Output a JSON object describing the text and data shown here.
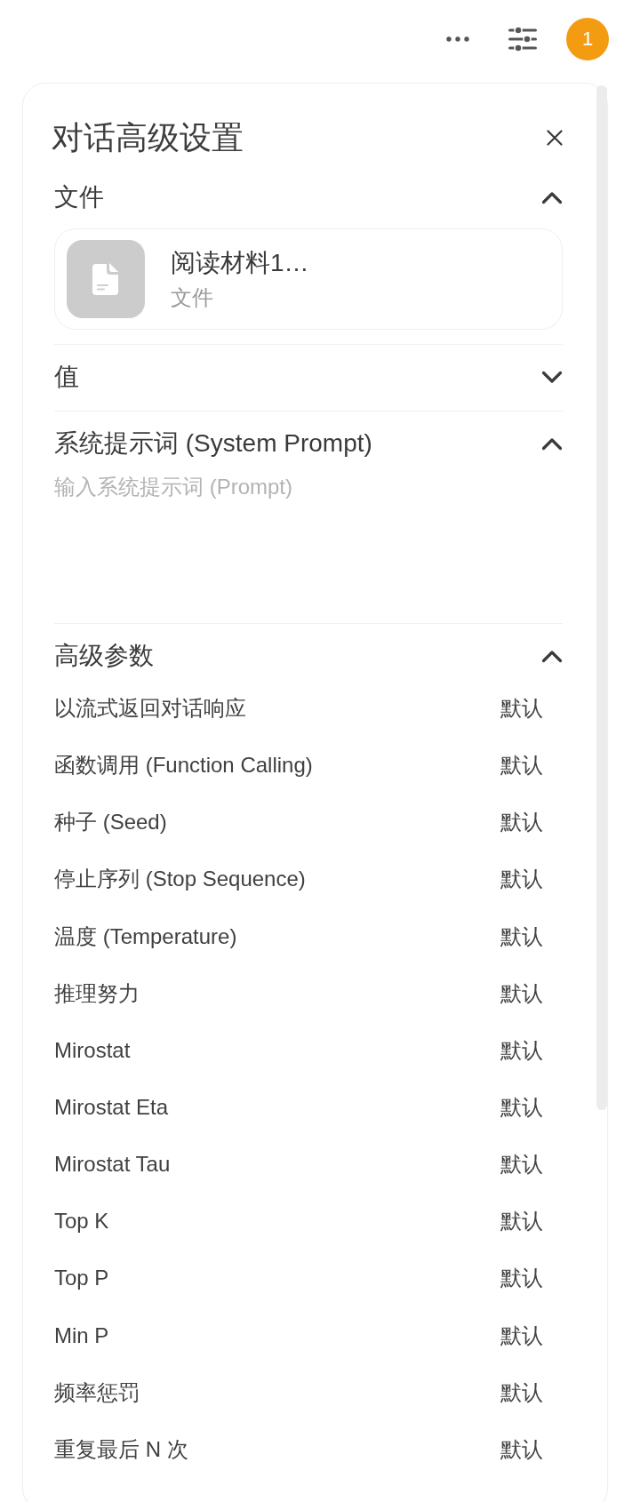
{
  "header": {
    "avatar": {
      "initial": "1"
    }
  },
  "panel": {
    "title": "对话高级设置",
    "sections": [
      {
        "kind": "files",
        "title": "文件",
        "expanded": true,
        "files": [
          {
            "name": "阅读材料1…",
            "type": "文件"
          }
        ]
      },
      {
        "kind": "values",
        "title": "值",
        "expanded": false
      },
      {
        "kind": "prompt",
        "title": "系统提示词 (System Prompt)",
        "expanded": true,
        "placeholder": "输入系统提示词 (Prompt)"
      },
      {
        "kind": "params",
        "title": "高级参数",
        "expanded": true,
        "params": [
          {
            "label": "以流式返回对话响应",
            "value": "默认"
          },
          {
            "label": "函数调用 (Function Calling)",
            "value": "默认"
          },
          {
            "label": "种子 (Seed)",
            "value": "默认"
          },
          {
            "label": "停止序列 (Stop Sequence)",
            "value": "默认"
          },
          {
            "label": "温度 (Temperature)",
            "value": "默认"
          },
          {
            "label": "推理努力",
            "value": "默认"
          },
          {
            "label": "Mirostat",
            "value": "默认"
          },
          {
            "label": "Mirostat Eta",
            "value": "默认"
          },
          {
            "label": "Mirostat Tau",
            "value": "默认"
          },
          {
            "label": "Top K",
            "value": "默认"
          },
          {
            "label": "Top P",
            "value": "默认"
          },
          {
            "label": "Min P",
            "value": "默认"
          },
          {
            "label": "频率惩罚",
            "value": "默认"
          },
          {
            "label": "重复最后 N 次",
            "value": "默认"
          }
        ]
      }
    ]
  }
}
